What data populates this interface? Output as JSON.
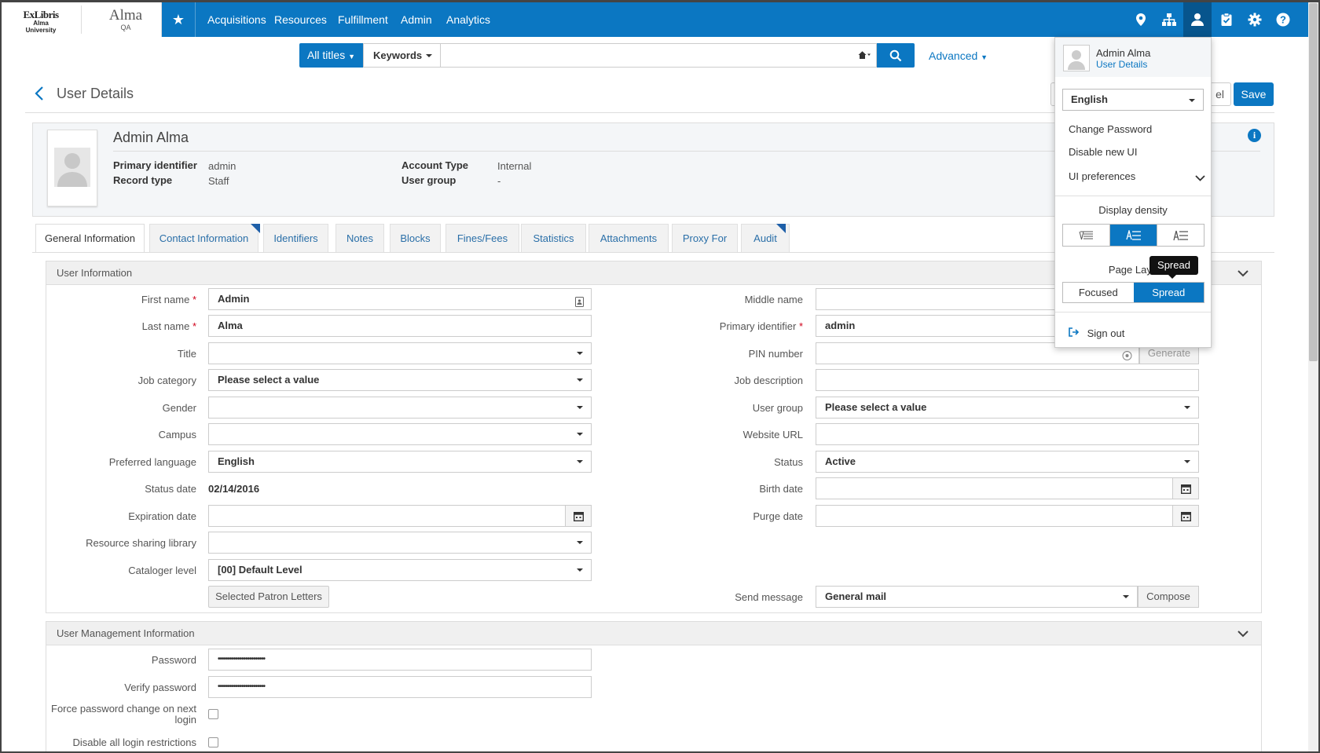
{
  "brand": {
    "exlibris": "ExLibris",
    "institution": "Alma University",
    "product": "Alma",
    "env": "QA"
  },
  "nav": {
    "items": [
      "Acquisitions",
      "Resources",
      "Fulfillment",
      "Admin",
      "Analytics"
    ]
  },
  "search": {
    "scope": "All titles",
    "field": "Keywords",
    "query": "",
    "advanced": "Advanced"
  },
  "header": {
    "title": "User Details",
    "cancel_label": "el",
    "save_label": "Save"
  },
  "user": {
    "name": "Admin Alma",
    "primary_identifier_label": "Primary identifier",
    "primary_identifier": "admin",
    "record_type_label": "Record type",
    "record_type": "Staff",
    "account_type_label": "Account Type",
    "account_type": "Internal",
    "user_group_label": "User group",
    "user_group": "-"
  },
  "tabs": [
    "General Information",
    "Contact Information",
    "Identifiers",
    "Notes",
    "Blocks",
    "Fines/Fees",
    "Statistics",
    "Attachments",
    "Proxy For",
    "Audit"
  ],
  "user_info": {
    "section_title": "User Information",
    "left": [
      {
        "label": "First name",
        "value": "Admin"
      },
      {
        "label": "Last name",
        "value": "Alma"
      },
      {
        "label": "Title",
        "value": ""
      },
      {
        "label": "Job category",
        "value": "Please select a value"
      },
      {
        "label": "Gender",
        "value": ""
      },
      {
        "label": "Campus",
        "value": ""
      },
      {
        "label": "Preferred language",
        "value": "English"
      },
      {
        "label": "Status date",
        "value": "02/14/2016"
      },
      {
        "label": "Expiration date",
        "value": ""
      },
      {
        "label": "Resource sharing library",
        "value": ""
      },
      {
        "label": "Cataloger level",
        "value": "[00] Default Level"
      }
    ],
    "right": [
      {
        "label": "Middle name",
        "value": ""
      },
      {
        "label": "Primary identifier",
        "value": "admin"
      },
      {
        "label": "PIN number",
        "value": ""
      },
      {
        "label": "Job description",
        "value": ""
      },
      {
        "label": "User group",
        "value": "Please select a value"
      },
      {
        "label": "Website URL",
        "value": ""
      },
      {
        "label": "Status",
        "value": "Active"
      },
      {
        "label": "Birth date",
        "value": ""
      },
      {
        "label": "Purge date",
        "value": ""
      },
      {
        "label": "Send message",
        "value": "General mail"
      }
    ],
    "generate_label": "Generate",
    "patron_letters_label": "Selected Patron Letters",
    "compose_label": "Compose"
  },
  "user_mgmt": {
    "section_title": "User Management Information",
    "password_label": "Password",
    "password_value": "••••••••••••••••••••••••",
    "verify_label": "Verify password",
    "verify_value": "••••••••••••••••••••••••",
    "force_change_label": "Force password change on next login",
    "disable_restrictions_label": "Disable all login restrictions"
  },
  "user_menu": {
    "name": "Admin Alma",
    "details_link": "User Details",
    "language": "English",
    "change_password": "Change Password",
    "disable_new_ui": "Disable new UI",
    "ui_preferences": "UI preferences",
    "display_density": "Display density",
    "page_layout": "Page Layo",
    "focused": "Focused",
    "spread": "Spread",
    "tooltip": "Spread",
    "sign_out": "Sign out"
  }
}
